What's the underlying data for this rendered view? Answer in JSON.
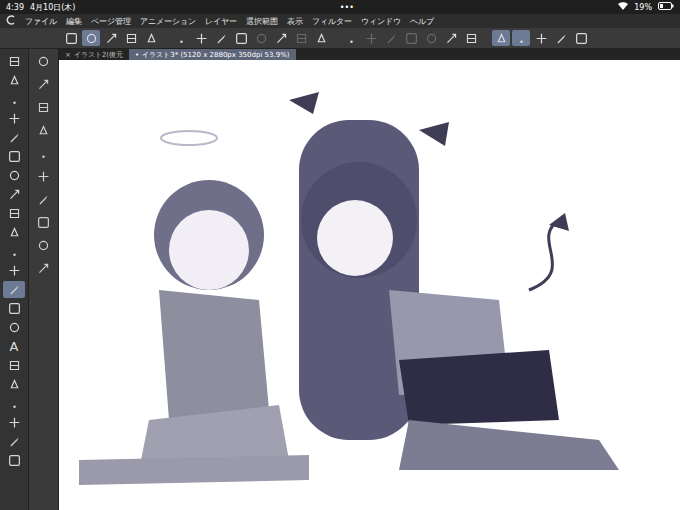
{
  "status_bar": {
    "time": "4:39",
    "date": "4月10日(木)",
    "dots": "•••",
    "battery": "19%"
  },
  "menu": [
    "ファイル",
    "編集",
    "ページ管理",
    "アニメーション",
    "レイヤー",
    "選択範囲",
    "表示",
    "フィルター",
    "ウィンドウ",
    "ヘルプ"
  ],
  "toolbar": [
    {
      "selected": false,
      "disabled": false
    },
    {
      "selected": true,
      "disabled": false
    },
    {
      "selected": false,
      "disabled": false
    },
    {
      "selected": false,
      "disabled": false
    },
    {
      "selected": false,
      "disabled": false
    },
    {
      "selected": false,
      "disabled": false
    },
    {
      "selected": false,
      "disabled": false
    },
    {
      "selected": false,
      "disabled": false
    },
    {
      "selected": false,
      "disabled": false
    },
    {
      "selected": false,
      "disabled": true
    },
    {
      "selected": false,
      "disabled": false
    },
    {
      "selected": false,
      "disabled": true
    },
    {
      "selected": false,
      "disabled": false
    },
    {
      "selected": false,
      "disabled": false
    },
    {
      "selected": false,
      "disabled": true
    },
    {
      "selected": false,
      "disabled": true
    },
    {
      "selected": false,
      "disabled": true
    },
    {
      "selected": false,
      "disabled": true
    },
    {
      "selected": false,
      "disabled": false
    },
    {
      "selected": false,
      "disabled": false
    },
    {
      "selected": true,
      "disabled": false
    },
    {
      "selected": true,
      "disabled": false
    },
    {
      "selected": false,
      "disabled": false
    },
    {
      "selected": false,
      "disabled": false
    },
    {
      "selected": false,
      "disabled": false
    }
  ],
  "tools": [
    {
      "kind": "icon",
      "selected": false
    },
    {
      "kind": "icon",
      "selected": false
    },
    {
      "kind": "icon",
      "selected": false
    },
    {
      "kind": "icon",
      "selected": false
    },
    {
      "kind": "icon",
      "selected": false
    },
    {
      "kind": "icon",
      "selected": false
    },
    {
      "kind": "icon",
      "selected": false
    },
    {
      "kind": "icon",
      "selected": false
    },
    {
      "kind": "icon",
      "selected": false
    },
    {
      "kind": "icon",
      "selected": false
    },
    {
      "kind": "icon",
      "selected": false
    },
    {
      "kind": "icon",
      "selected": false
    },
    {
      "kind": "icon",
      "selected": true
    },
    {
      "kind": "icon",
      "selected": false
    },
    {
      "kind": "icon",
      "selected": false
    },
    {
      "kind": "glyph",
      "glyph": "A",
      "selected": false
    },
    {
      "kind": "icon",
      "selected": false
    },
    {
      "kind": "icon",
      "selected": false
    },
    {
      "kind": "icon",
      "selected": false
    },
    {
      "kind": "icon",
      "selected": false
    },
    {
      "kind": "icon",
      "selected": false
    },
    {
      "kind": "icon",
      "selected": false
    }
  ],
  "subtools": [
    {
      "selected": false
    },
    {
      "selected": false
    },
    {
      "selected": false
    },
    {
      "selected": false
    },
    {
      "selected": false
    },
    {
      "selected": false
    },
    {
      "selected": false
    },
    {
      "selected": false
    },
    {
      "selected": false
    },
    {
      "selected": false
    }
  ],
  "tabs": [
    {
      "mark": "×",
      "label": "イラスト2(復元",
      "selected": false
    },
    {
      "mark": "•",
      "label": "イラスト3* (5120 x 2880px 350dpi 53.9%)",
      "selected": true
    }
  ]
}
